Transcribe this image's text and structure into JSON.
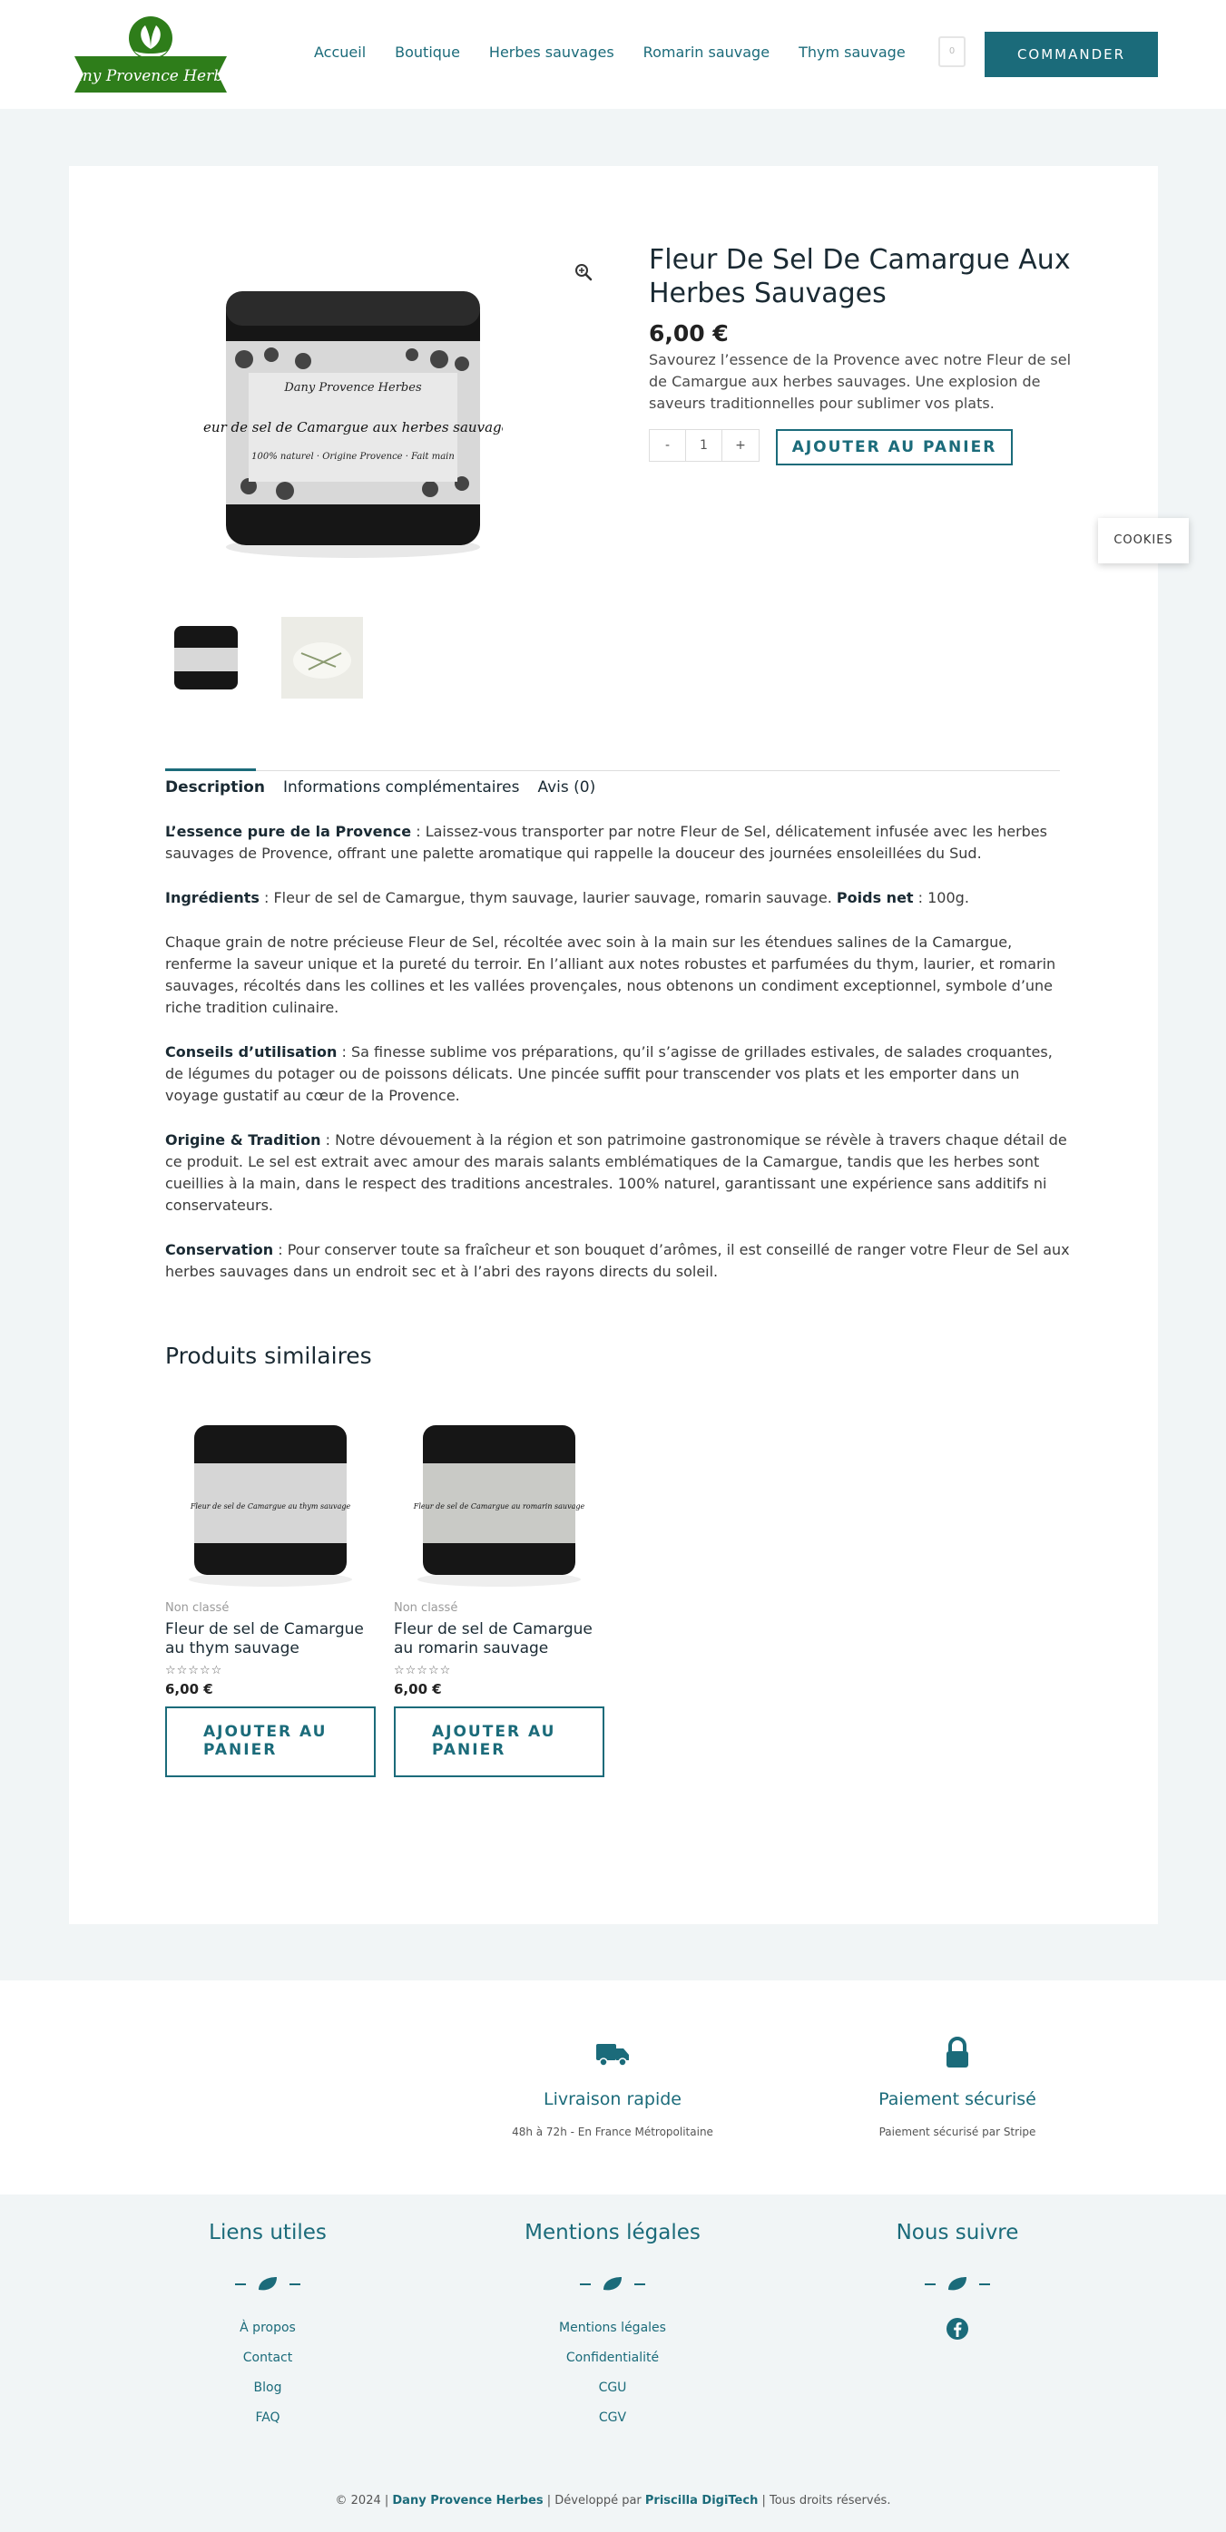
{
  "header": {
    "logo_text": "Dany Provence Herbes",
    "nav": [
      "Accueil",
      "Boutique",
      "Herbes sauvages",
      "Romarin sauvage",
      "Thym sauvage"
    ],
    "cart_count": "0",
    "cta_label": "COMMANDER"
  },
  "product": {
    "title": "Fleur De Sel De Camargue Aux Herbes Sauvages",
    "price": "6,00 €",
    "short_description": "Savourez l’essence de la Provence avec notre Fleur de sel de Camargue aux herbes sauvages. Une explosion de saveurs traditionnelles pour sublimer vos plats.",
    "qty_minus": "-",
    "qty_value": "1",
    "qty_plus": "+",
    "add_to_cart": "AJOUTER AU PANIER",
    "tin_label_brand": "Dany Provence Herbes",
    "tin_label_name": "Fleur de sel de Camargue aux herbes sauvages",
    "tin_label_sub": "100% naturel · Origine Provence · Fait main"
  },
  "tabs": [
    "Description",
    "Informations complémentaires",
    "Avis (0)"
  ],
  "description": [
    {
      "lead": "L’essence pure de la Provence",
      "text": " : Laissez-vous transporter par notre Fleur de Sel, délicatement infusée avec les herbes sauvages de Provence, offrant une palette aromatique qui rappelle la douceur des journées ensoleillées du Sud."
    },
    {
      "lead": "Ingrédients",
      "text": " : Fleur de sel de Camargue, thym sauvage, laurier sauvage, romarin sauvage. ",
      "lead2": "Poids net",
      "text2": " : 100g."
    },
    {
      "lead": "",
      "text": "Chaque grain de notre précieuse Fleur de Sel, récoltée avec soin à la main sur les étendues salines de la Camargue, renferme la saveur unique et la pureté du terroir. En l’alliant aux notes robustes et parfumées du thym, laurier, et romarin sauvages, récoltés dans les collines et les vallées provençales, nous obtenons un condiment exceptionnel, symbole d’une riche tradition culinaire."
    },
    {
      "lead": "Conseils d’utilisation",
      "text": " : Sa finesse sublime vos préparations, qu’il s’agisse de grillades estivales, de salades croquantes, de légumes du potager ou de poissons délicats. Une pincée suffit pour transcender vos plats et les emporter dans un voyage gustatif au cœur de la Provence."
    },
    {
      "lead": "Origine & Tradition",
      "text": " : Notre dévouement à la région et son patrimoine gastronomique se révèle à travers chaque détail de ce produit. Le sel est extrait avec amour des marais salants emblématiques de la Camargue, tandis que les herbes sont cueillies à la main, dans le respect des traditions ancestrales. 100% naturel, garantissant une expérience sans additifs ni conservateurs."
    },
    {
      "lead": "Conservation",
      "text": " : Pour conserver toute sa fraîcheur et son bouquet d’arômes, il est conseillé de ranger votre Fleur de Sel aux herbes sauvages dans un endroit sec et à l’abri des rayons directs du soleil."
    }
  ],
  "similar": {
    "title": "Produits similaires",
    "items": [
      {
        "category": "Non classé",
        "name": "Fleur de sel de Camargue au thym sauvage",
        "stars": "☆☆☆☆☆",
        "price": "6,00 €",
        "button": "AJOUTER AU PANIER",
        "tin_label": "Fleur de sel de Camargue au thym sauvage"
      },
      {
        "category": "Non classé",
        "name": "Fleur de sel de Camargue au romarin sauvage",
        "stars": "☆☆☆☆☆",
        "price": "6,00 €",
        "button": "AJOUTER AU PANIER",
        "tin_label": "Fleur de sel de Camargue au romarin sauvage"
      }
    ]
  },
  "cookies_label": "COOKIES",
  "features": [
    {
      "icon": "truck-icon",
      "title": "Livraison rapide",
      "subtitle": "48h à 72h - En France Métropolitaine"
    },
    {
      "icon": "lock-icon",
      "title": "Paiement sécurisé",
      "subtitle": "Paiement sécurisé par Stripe"
    }
  ],
  "footer": {
    "columns": [
      {
        "heading": "Liens utiles",
        "links": [
          "À propos",
          "Contact",
          "Blog",
          "FAQ"
        ]
      },
      {
        "heading": "Mentions légales",
        "links": [
          "Mentions légales",
          "Confidentialité",
          "CGU",
          "CGV"
        ]
      },
      {
        "heading": "Nous suivre",
        "links": []
      }
    ],
    "copyright_pre": "© 2024 | ",
    "copyright_brand": "Dany Provence Herbes",
    "copyright_mid": " | Développé par ",
    "copyright_dev": "Priscilla DigiTech",
    "copyright_post": " | Tous droits réservés."
  },
  "colors": {
    "accent": "#1b6b7a",
    "logo_green": "#2e7d1a",
    "background": "#f1f5f6"
  }
}
